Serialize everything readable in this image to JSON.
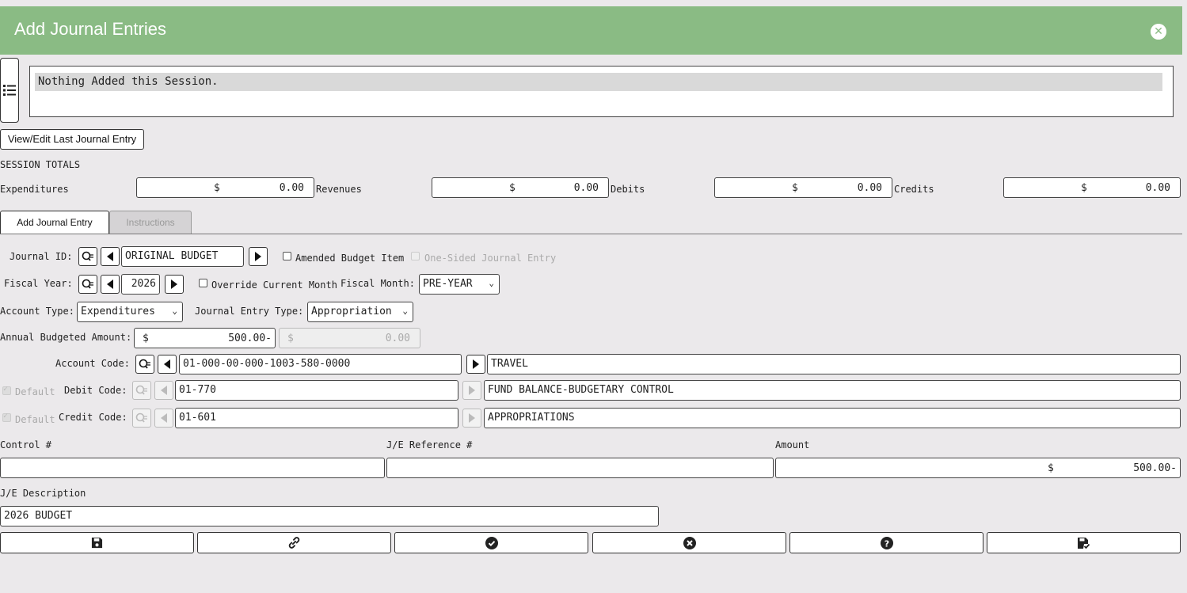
{
  "header": {
    "title": "Add Journal Entries"
  },
  "session": {
    "message": "Nothing Added this Session."
  },
  "view_edit_button": "View/Edit Last Journal Entry",
  "totals": {
    "heading": "SESSION TOTALS",
    "items": [
      {
        "label": "Expenditures",
        "currency": "$",
        "value": "0.00"
      },
      {
        "label": "Revenues",
        "currency": "$",
        "value": "0.00"
      },
      {
        "label": "Debits",
        "currency": "$",
        "value": "0.00"
      },
      {
        "label": "Credits",
        "currency": "$",
        "value": "0.00"
      }
    ]
  },
  "tabs": [
    {
      "label": "Add Journal Entry",
      "active": true
    },
    {
      "label": "Instructions",
      "active": false
    }
  ],
  "form": {
    "journal_id_label": "Journal ID:",
    "journal_id_value": "ORIGINAL BUDGET",
    "amended_label": "Amended Budget Item",
    "one_sided_label": "One-Sided Journal Entry",
    "fiscal_year_label": "Fiscal Year:",
    "fiscal_year_value": "2026",
    "override_label": "Override Current Month",
    "fiscal_month_label": "Fiscal Month:",
    "fiscal_month_value": "PRE-YEAR",
    "account_type_label": "Account Type:",
    "account_type_value": "Expenditures",
    "je_type_label": "Journal Entry Type:",
    "je_type_value": "Appropriation",
    "annual_label": "Annual Budgeted Amount:",
    "annual_currency": "$",
    "annual_value": "500.00-",
    "annual2_currency": "$",
    "annual2_value": "0.00",
    "account_code_label": "Account Code:",
    "account_code_value": "01-000-00-000-1003-580-0000",
    "account_code_desc": "TRAVEL",
    "default_label": "Default",
    "debit_code_label": "Debit Code:",
    "debit_code_value": "01-770",
    "debit_code_desc": "FUND BALANCE-BUDGETARY CONTROL",
    "credit_code_label": "Credit Code:",
    "credit_code_value": "01-601",
    "credit_code_desc": "APPROPRIATIONS",
    "control_label": "Control #",
    "control_value": "",
    "reference_label": "J/E Reference #",
    "reference_value": "",
    "amount_label": "Amount",
    "amount_currency": "$",
    "amount_value": "500.00-",
    "description_label": "J/E Description",
    "description_value": "2026 BUDGET"
  },
  "footer_buttons": [
    {
      "icon": "save-icon"
    },
    {
      "icon": "attach-icon"
    },
    {
      "icon": "check-icon"
    },
    {
      "icon": "cancel-icon"
    },
    {
      "icon": "help-icon"
    },
    {
      "icon": "save-verify-icon"
    }
  ],
  "colors": {
    "header": "#8abb84",
    "background": "#ebe9eb"
  }
}
